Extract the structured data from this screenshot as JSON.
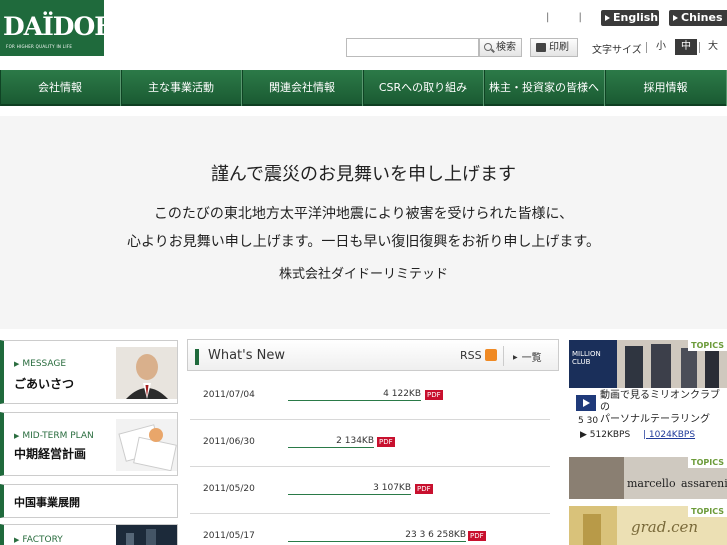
{
  "header": {
    "logo_text": "DAÏDOH",
    "logo_tagline": "FOR HIGHER QUALITY IN LIFE",
    "top_separators": "| | |",
    "lang_english": "English",
    "lang_chinese": "Chines",
    "search_label": "検索",
    "print_label": "印刷",
    "font_size_label": "文字サイズ",
    "font_sizes": [
      "小",
      "中",
      "大"
    ]
  },
  "nav": {
    "items": [
      "会社情報",
      "主な事業活動",
      "関連会社情報",
      "CSRへの取り組み",
      "株主・投資家の皆様へ",
      "採用情報"
    ]
  },
  "banner": {
    "heading": "謹んで震災のお見舞いを申し上げます",
    "line1": "このたびの東北地方太平洋沖地震により被害を受けられた皆様に、",
    "line2": "心よりお見舞い申し上げます。一日も早い復旧復興をお祈り申し上げます。",
    "signature": "株式会社ダイドーリミテッド"
  },
  "sidebar": {
    "message_eyebrow": "MESSAGE",
    "message_title": "ごあいさつ",
    "plan_eyebrow": "MID-TERM PLAN",
    "plan_title": "中期経営計画",
    "china_title": "中国事業展開",
    "factory_eyebrow": "FACTORY"
  },
  "whats_new": {
    "title": "What's New",
    "rss": "RSS",
    "list": "一覧",
    "items": [
      {
        "date": "2011/07/04",
        "link": "4  122KB",
        "pdf": "PDF"
      },
      {
        "date": "2011/06/30",
        "link": "2  134KB",
        "pdf": "PDF"
      },
      {
        "date": "2011/05/20",
        "link": "3  107KB",
        "pdf": "PDF"
      },
      {
        "date": "2011/05/17",
        "link": "23 3          6  258KB",
        "pdf": "PDF"
      }
    ]
  },
  "topics": {
    "tag": "TOPICS",
    "million_club": "MILLION CLUB",
    "caption_line1": "動画で見るミリオンクラブの",
    "caption_line2": "パーソナルテーラリング",
    "number": "5 30",
    "kbps1": "512KBPS",
    "kbps2": "1024KBPS",
    "marcello": "marcello",
    "sassareni": "assareni",
    "graduate": "grad.cen"
  },
  "colors": {
    "brand_green": "#1f6a3c",
    "pdf_red": "#c8102e",
    "rss_orange": "#f08a24"
  }
}
